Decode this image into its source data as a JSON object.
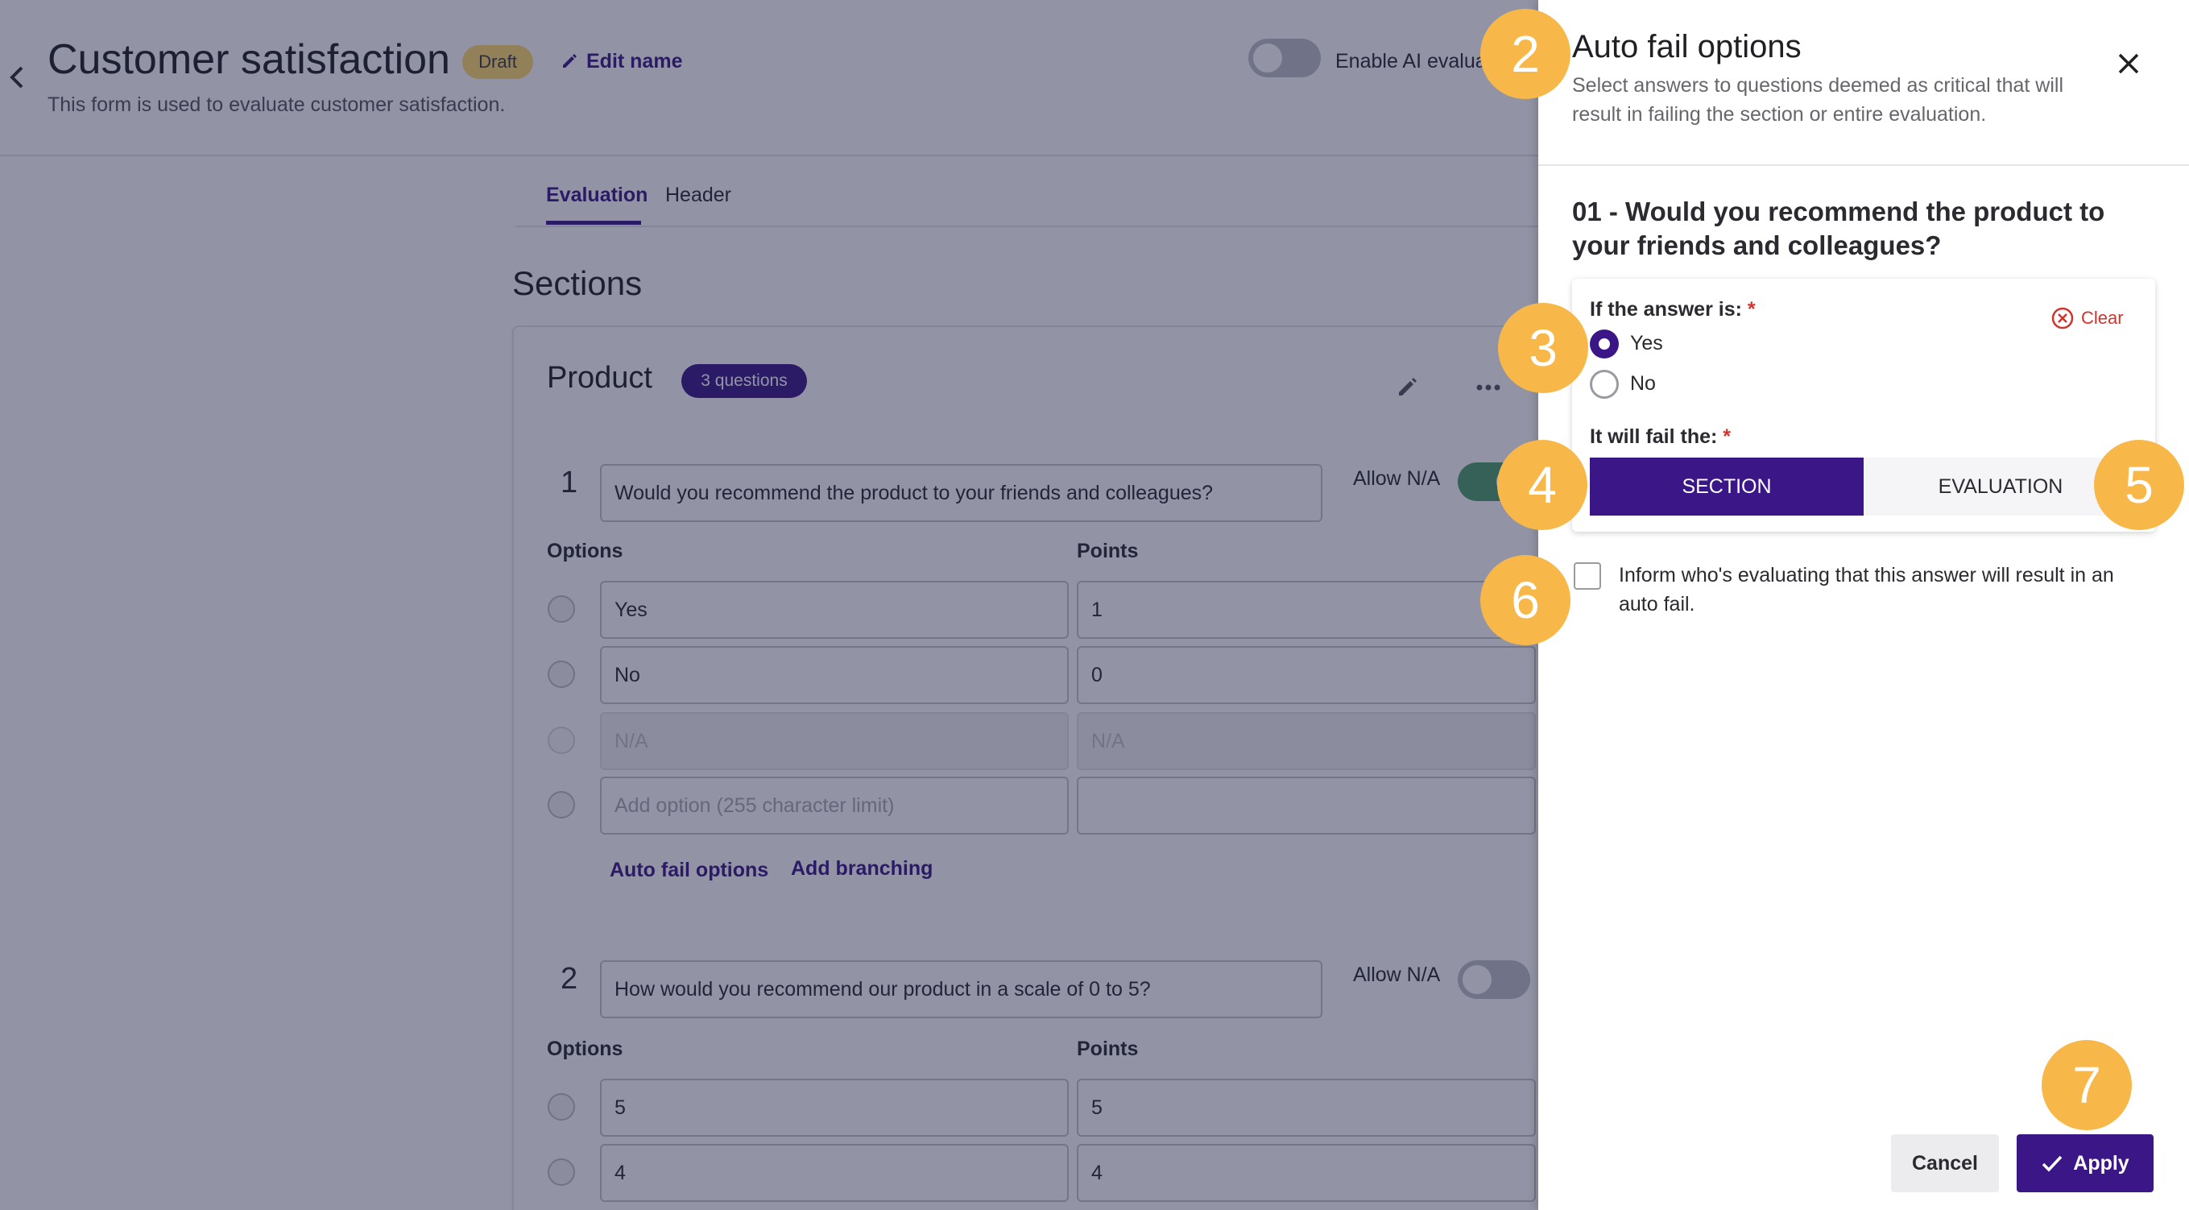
{
  "header": {
    "title": "Customer satisfaction",
    "status_badge": "Draft",
    "edit_name_label": "Edit name",
    "description": "This form is used to evaluate customer satisfaction.",
    "ai_toggle_label": "Enable AI evaluat"
  },
  "tabs": [
    {
      "label": "Evaluation",
      "active": true
    },
    {
      "label": "Header",
      "active": false
    }
  ],
  "sections_title": "Sections",
  "section": {
    "name": "Product",
    "question_count": "3 questions",
    "options_label": "Options",
    "points_label": "Points",
    "allow_na_label": "Allow N/A",
    "auto_fail_link": "Auto fail options",
    "add_branching_link": "Add branching",
    "questions": [
      {
        "number": "1",
        "text": "Would you recommend the product to your friends and colleagues?",
        "allow_na": true,
        "options": [
          {
            "label": "Yes",
            "points": "1"
          },
          {
            "label": "No",
            "points": "0"
          }
        ],
        "na_option_placeholder": "N/A",
        "na_points_placeholder": "N/A",
        "add_option_placeholder": "Add option (255 character limit)"
      },
      {
        "number": "2",
        "text": "How would you recommend our product in a scale of 0 to 5?",
        "allow_na": false,
        "options": [
          {
            "label": "5",
            "points": "5"
          },
          {
            "label": "4",
            "points": "4"
          }
        ]
      }
    ]
  },
  "panel": {
    "title": "Auto fail options",
    "subtitle": "Select answers to questions deemed as critical that will result in failing the section or entire evaluation.",
    "question_title": "01 - Would you recommend the product to your friends and colleagues?",
    "answer_label": "If the answer is:",
    "required_mark": "*",
    "clear_label": "Clear",
    "answers": [
      {
        "label": "Yes",
        "selected": true
      },
      {
        "label": "No",
        "selected": false
      }
    ],
    "fail_label": "It will fail the:",
    "scope_options": [
      {
        "label": "SECTION",
        "selected": true
      },
      {
        "label": "EVALUATION",
        "selected": false
      }
    ],
    "inform_label": "Inform who's evaluating that this answer will result in an auto fail.",
    "inform_checked": false,
    "cancel_label": "Cancel",
    "apply_label": "Apply"
  },
  "step_markers": [
    "2",
    "3",
    "4",
    "5",
    "6",
    "7"
  ],
  "colors": {
    "brand": "#3b1687",
    "callout": "#f7b849",
    "toggle_on": "#4f9e6e",
    "required": "#d0342c",
    "badge": "#ffd86e"
  }
}
